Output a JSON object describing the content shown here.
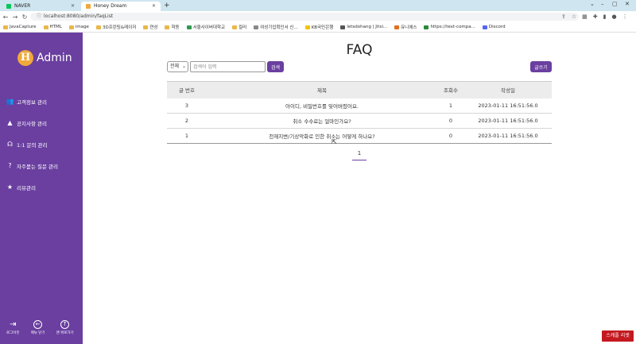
{
  "browser": {
    "tabs": [
      {
        "title": "NAVER",
        "favicon_color": "#03c75a",
        "active": false
      },
      {
        "title": "Honey Dream",
        "favicon_color": "#f0a93b",
        "active": true
      }
    ],
    "new_tab_label": "+",
    "url": "localhost:8080/admin/faqList",
    "bookmarks": [
      "JavaCapture",
      "HTML",
      "image",
      "3D프린팅&레이저",
      "연성",
      "학동",
      "서울사이버대학교",
      "컬러",
      "여성기업확인서 신...",
      "KB국민은행",
      "letsdohang | Jitsi...",
      "유니에스",
      "https://text-compa...",
      "Discord"
    ]
  },
  "sidebar": {
    "logo_mark": "H",
    "logo_text": "Admin",
    "items": [
      {
        "label": "고객정보 관리",
        "icon": "users-icon"
      },
      {
        "label": "공지사항 관리",
        "icon": "warning-icon"
      },
      {
        "label": "1:1 문의 관리",
        "icon": "headset-icon"
      },
      {
        "label": "자주묻는 질문 관리",
        "icon": "question-icon"
      },
      {
        "label": "리뷰관리",
        "icon": "star-icon"
      }
    ],
    "bottom": {
      "logout": "로그아웃",
      "menu_collapse": "메뉴 닫기",
      "scroll_top": "맨 위로가기"
    }
  },
  "main": {
    "title": "FAQ",
    "search": {
      "select_value": "전체",
      "placeholder": "검색어 입력",
      "button": "검색"
    },
    "write_button": "글쓰기",
    "table": {
      "headers": [
        "글 번호",
        "제목",
        "조회수",
        "작성일"
      ],
      "rows": [
        [
          "3",
          "아이디, 비밀번호를 잊어버렸어요.",
          "1",
          "2023-01-11 16:51:56.0"
        ],
        [
          "2",
          "취소 수수료는 얼마인가요?",
          "0",
          "2023-01-11 16:51:56.0"
        ],
        [
          "1",
          "천재지변/기상악화로 인한 취소는 어떻게 하나요?",
          "0",
          "2023-01-11 16:51:56.0"
        ]
      ]
    },
    "pagination": [
      "1"
    ]
  },
  "recorder_label": "스캐플 리셋",
  "colors": {
    "accent": "#6a3fa0",
    "logo": "#f0a93b",
    "recorder": "#c41920"
  }
}
